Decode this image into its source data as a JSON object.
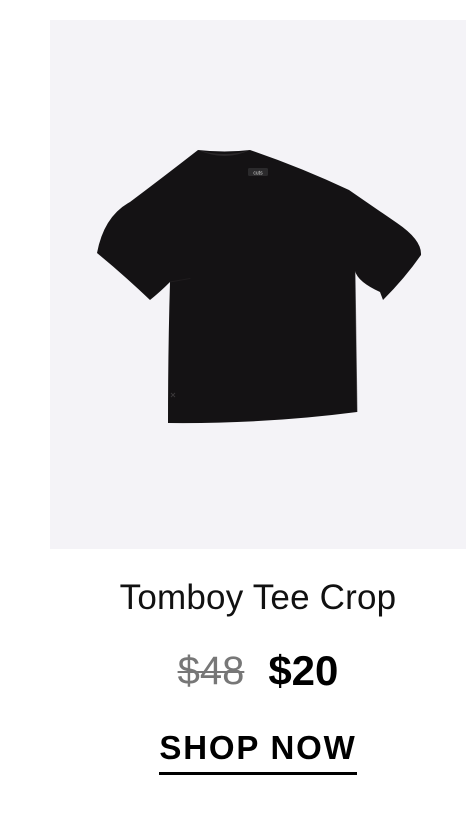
{
  "product": {
    "image_alt": "Black cropped t-shirt",
    "neck_label_text": "cuts",
    "name": "Tomboy Tee Crop",
    "price_original": "$48",
    "price_sale": "$20",
    "cta_label": "SHOP NOW"
  },
  "colors": {
    "image_background": "#f4f3f7",
    "garment": "#141214",
    "original_price": "#777777",
    "text": "#111111"
  }
}
